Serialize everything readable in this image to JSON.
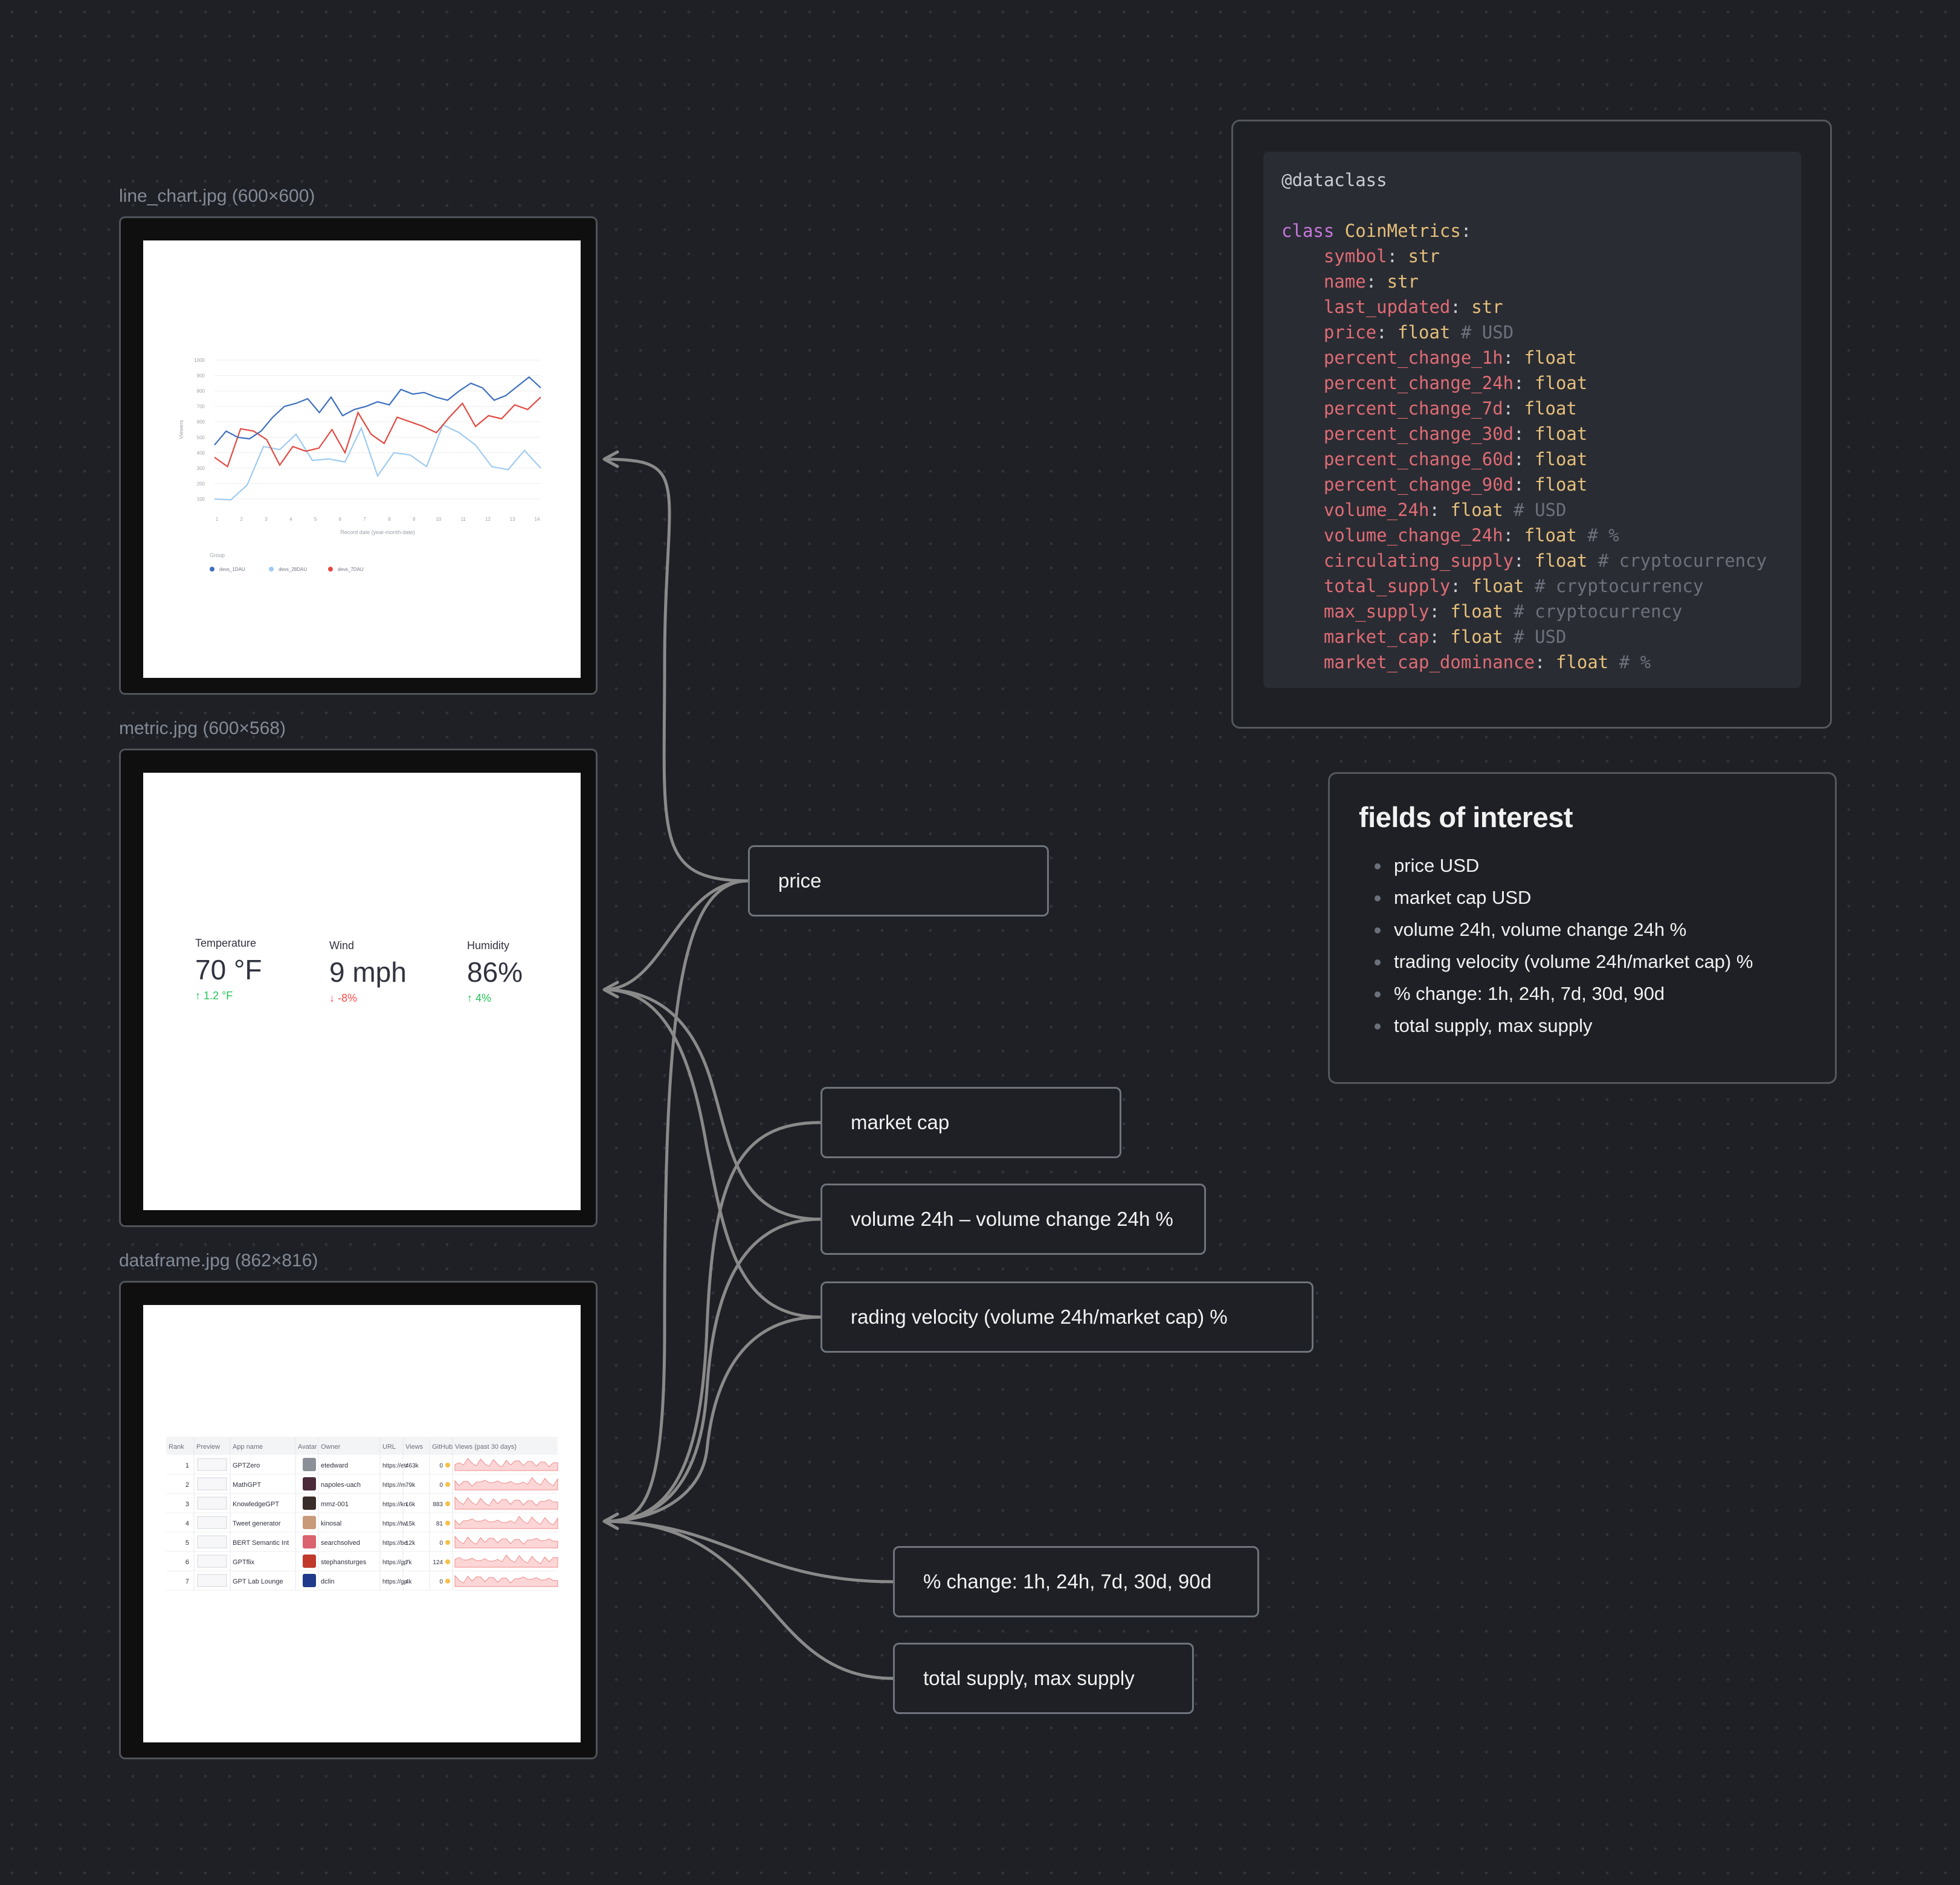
{
  "images": {
    "line_chart": {
      "caption": "line_chart.jpg (600×600)"
    },
    "metric": {
      "caption": "metric.jpg (600×568)"
    },
    "dataframe": {
      "caption": "dataframe.jpg (862×816)"
    }
  },
  "line_chart_thumb": {
    "y_ticks": [
      "1000",
      "900",
      "800",
      "700",
      "600",
      "500",
      "400",
      "300",
      "200",
      "100"
    ],
    "x_ticks": [
      "1",
      "2",
      "3",
      "4",
      "5",
      "6",
      "7",
      "8",
      "9",
      "10",
      "11",
      "12",
      "13",
      "14"
    ],
    "ylabel": "Viewers",
    "xlabel": "Record date (year-month-date)",
    "legend_title": "Group",
    "legend": [
      "devs_1DAU",
      "devs_28DAU",
      "devs_7DAU"
    ],
    "colors": {
      "devs_1DAU": "#3d6fbf",
      "devs_28DAU": "#9fcbf1",
      "devs_7DAU": "#e24a42"
    }
  },
  "metrics": [
    {
      "label": "Temperature",
      "value": "70 °F",
      "delta": "1.2 °F",
      "direction": "up"
    },
    {
      "label": "Wind",
      "value": "9 mph",
      "delta": "-8%",
      "direction": "down"
    },
    {
      "label": "Humidity",
      "value": "86%",
      "delta": "4%",
      "direction": "up"
    }
  ],
  "dataframe_thumb": {
    "headers": [
      "Rank",
      "Preview",
      "App name",
      "Avatar",
      "Owner",
      "URL",
      "Views",
      "GitHub",
      "Views (past 30 days)"
    ],
    "rows": [
      {
        "rank": "1",
        "app": "GPTZero",
        "owner": "etedward",
        "url": "https://etr",
        "views": "463k",
        "github": "0"
      },
      {
        "rank": "2",
        "app": "MathGPT",
        "owner": "napoles-uach",
        "url": "https://m",
        "views": "79k",
        "github": "0"
      },
      {
        "rank": "3",
        "app": "KnowledgeGPT",
        "owner": "mmz-001",
        "url": "https://kn",
        "views": "16k",
        "github": "883"
      },
      {
        "rank": "4",
        "app": "Tweet generator",
        "owner": "kinosal",
        "url": "https://tw",
        "views": "15k",
        "github": "81"
      },
      {
        "rank": "5",
        "app": "BERT Semantic Int",
        "owner": "searchsolved",
        "url": "https://be",
        "views": "12k",
        "github": "0"
      },
      {
        "rank": "6",
        "app": "GPTflix",
        "owner": "stephansturges",
        "url": "https://gp",
        "views": "7k",
        "github": "124"
      },
      {
        "rank": "7",
        "app": "GPT Lab Lounge",
        "owner": "dclin",
        "url": "https://gp",
        "views": "4k",
        "github": "0"
      }
    ]
  },
  "nodes": {
    "price": "price",
    "market_cap": "market cap",
    "volume": "volume 24h – volume change 24h %",
    "velocity": "rading velocity (volume 24h/market cap) %",
    "pct_change": "% change: 1h, 24h, 7d, 30d, 90d",
    "supply": "total supply, max supply"
  },
  "code": {
    "decorator": "@dataclass",
    "class_kw": "class",
    "class_name": "CoinMetrics",
    "fields": [
      {
        "name": "symbol",
        "type": "str",
        "comment": ""
      },
      {
        "name": "name",
        "type": "str",
        "comment": ""
      },
      {
        "name": "last_updated",
        "type": "str",
        "comment": ""
      },
      {
        "name": "price",
        "type": "float",
        "comment": "# USD"
      },
      {
        "name": "percent_change_1h",
        "type": "float",
        "comment": ""
      },
      {
        "name": "percent_change_24h",
        "type": "float",
        "comment": ""
      },
      {
        "name": "percent_change_7d",
        "type": "float",
        "comment": ""
      },
      {
        "name": "percent_change_30d",
        "type": "float",
        "comment": ""
      },
      {
        "name": "percent_change_60d",
        "type": "float",
        "comment": ""
      },
      {
        "name": "percent_change_90d",
        "type": "float",
        "comment": ""
      },
      {
        "name": "volume_24h",
        "type": "float",
        "comment": "# USD"
      },
      {
        "name": "volume_change_24h",
        "type": "float",
        "comment": "# %"
      },
      {
        "name": "circulating_supply",
        "type": "float",
        "comment": "# cryptocurrency"
      },
      {
        "name": "total_supply",
        "type": "float",
        "comment": "# cryptocurrency"
      },
      {
        "name": "max_supply",
        "type": "float",
        "comment": "# cryptocurrency"
      },
      {
        "name": "market_cap",
        "type": "float",
        "comment": "# USD"
      },
      {
        "name": "market_cap_dominance",
        "type": "float",
        "comment": "# %"
      }
    ]
  },
  "fields_of_interest": {
    "title": "fields of interest",
    "items": [
      "price USD",
      "market cap USD",
      "volume 24h, volume change 24h %",
      "trading velocity (volume 24h/market cap) %",
      "% change: 1h, 24h, 7d, 30d, 90d",
      "total supply, max supply"
    ]
  }
}
